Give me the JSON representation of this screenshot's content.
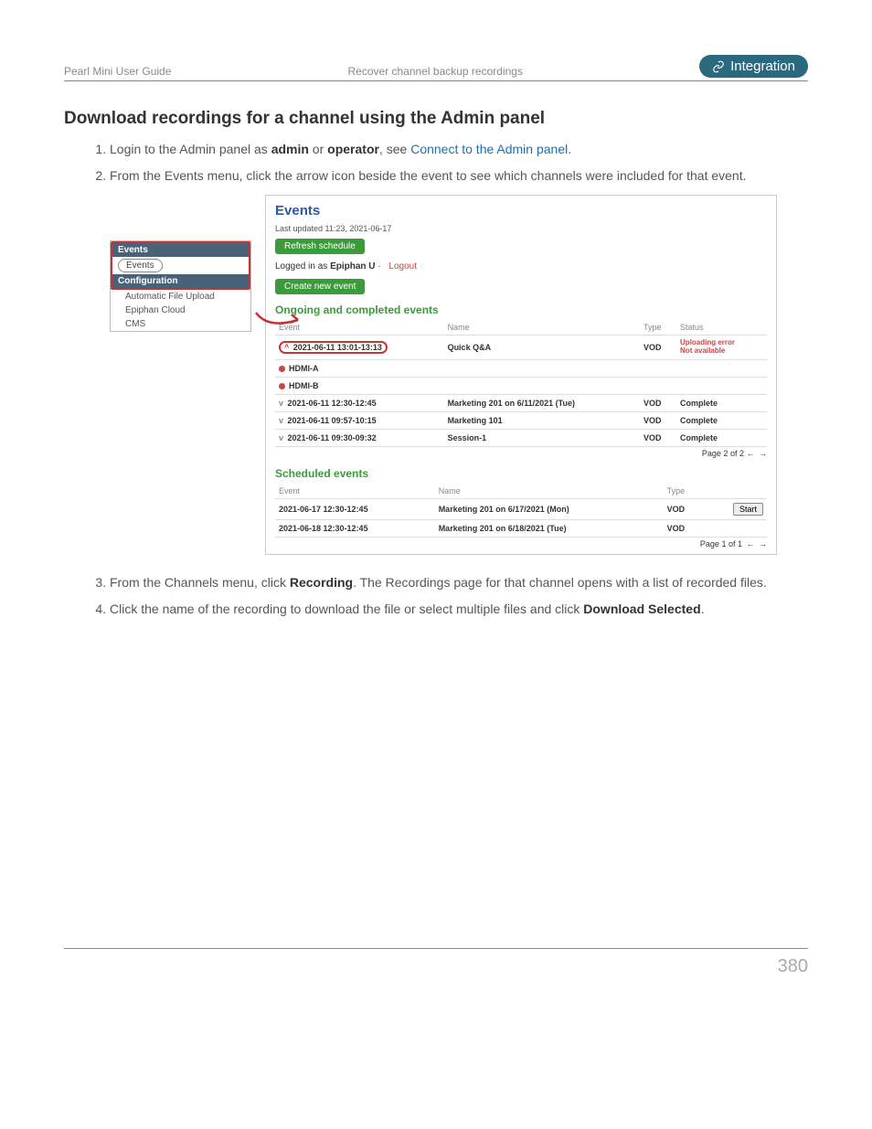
{
  "header": {
    "guide": "Pearl Mini User Guide",
    "section": "Recover channel backup recordings",
    "badge": "Integration"
  },
  "title": "Download recordings for a channel using the Admin panel",
  "steps": {
    "s1_a": "Login to the Admin panel as ",
    "s1_admin": "admin",
    "s1_or": " or ",
    "s1_op": "operator",
    "s1_see": ", see ",
    "s1_link": "Connect to the Admin panel",
    "s1_end": ".",
    "s2": "From the Events menu, click the arrow icon beside the event to see which channels were included for that event.",
    "s3_a": "From the Channels menu, click ",
    "s3_b": "Recording",
    "s3_c": ". The Recordings page for that channel opens with a list of recorded files.",
    "s4_a": "Click the name of the recording to download the file or select multiple files and click ",
    "s4_b": "Download Selected",
    "s4_c": "."
  },
  "sidebar": {
    "events_head": "Events",
    "events_item": "Events",
    "config_head": "Configuration",
    "items": [
      "Automatic File Upload",
      "Epiphan Cloud",
      "CMS"
    ]
  },
  "panel": {
    "title": "Events",
    "last_updated": "Last updated 11:23, 2021-06-17",
    "refresh": "Refresh schedule",
    "logged_in_pre": "Logged in as ",
    "logged_in_user": "Epiphan U",
    "logout": "Logout",
    "create": "Create new event",
    "ongoing_head": "Ongoing and completed events",
    "scheduled_head": "Scheduled events",
    "cols": {
      "event": "Event",
      "name": "Name",
      "type": "Type",
      "status": "Status"
    },
    "ongoing": [
      {
        "time": "2021-06-11 13:01-13:13",
        "name": "Quick Q&A",
        "type": "VOD",
        "status1": "Uploading error",
        "status2": "Not available",
        "open": true
      },
      {
        "hdmi": "HDMI-A"
      },
      {
        "hdmi": "HDMI-B"
      },
      {
        "time": "2021-06-11 12:30-12:45",
        "name": "Marketing 201 on 6/11/2021 (Tue)",
        "type": "VOD",
        "status": "Complete"
      },
      {
        "time": "2021-06-11 09:57-10:15",
        "name": "Marketing 101",
        "type": "VOD",
        "status": "Complete"
      },
      {
        "time": "2021-06-11 09:30-09:32",
        "name": "Session-1",
        "type": "VOD",
        "status": "Complete"
      }
    ],
    "pager1": "Page 2 of 2",
    "scheduled": [
      {
        "time": "2021-06-17 12:30-12:45",
        "name": "Marketing 201 on 6/17/2021 (Mon)",
        "type": "VOD",
        "start": "Start"
      },
      {
        "time": "2021-06-18 12:30-12:45",
        "name": "Marketing 201 on 6/18/2021 (Tue)",
        "type": "VOD"
      }
    ],
    "pager2": "Page 1 of 1"
  },
  "page_number": "380"
}
